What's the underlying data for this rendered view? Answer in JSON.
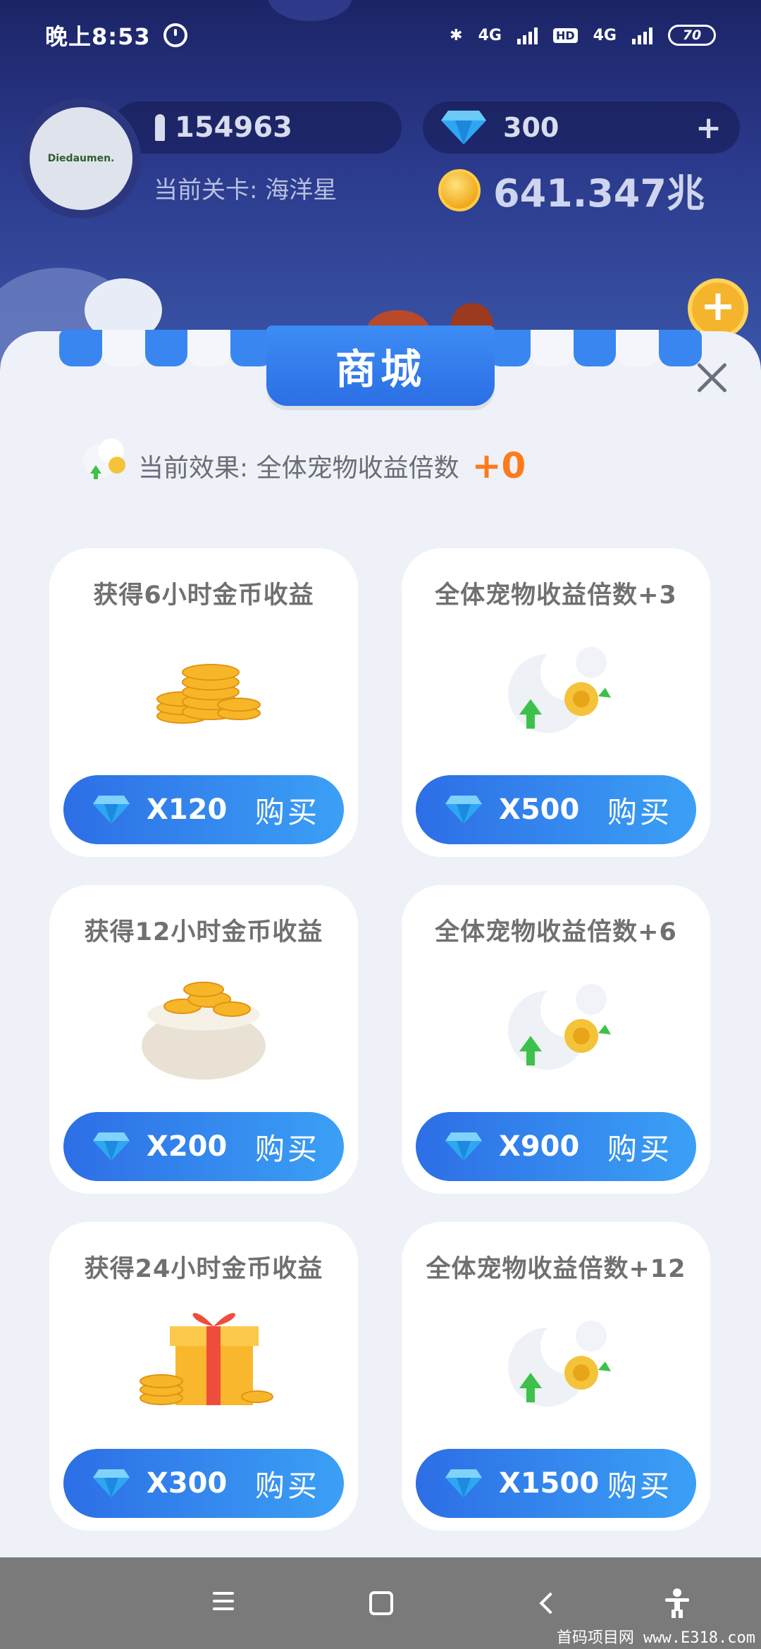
{
  "status_bar": {
    "time": "晚上8:53",
    "network_1": "4G",
    "hd_badge": "HD",
    "network_2": "4G",
    "battery": "70"
  },
  "player": {
    "avatar_text": "Diedaumen.",
    "score": "154963",
    "current_level_label": "当前关卡: 海洋星",
    "gems": "300",
    "gems_add": "+",
    "coins": "641.347兆"
  },
  "shop": {
    "title": "商城",
    "current_effect_label": "当前效果: 全体宠物收益倍数",
    "current_effect_value": "+0",
    "buy_label": "购买",
    "items": [
      {
        "title": "获得6小时金币收益",
        "price": "X120",
        "art": "coin-stack"
      },
      {
        "title": "全体宠物收益倍数+3",
        "price": "X500",
        "art": "cloud-boost"
      },
      {
        "title": "获得12小时金币收益",
        "price": "X200",
        "art": "coin-bag"
      },
      {
        "title": "全体宠物收益倍数+6",
        "price": "X900",
        "art": "cloud-boost"
      },
      {
        "title": "获得24小时金币收益",
        "price": "X300",
        "art": "gift-box"
      },
      {
        "title": "全体宠物收益倍数+12",
        "price": "X1500",
        "art": "cloud-boost"
      }
    ]
  },
  "colors": {
    "accent_blue": "#2d6ee6",
    "effect_orange": "#ff7a1a",
    "card_bg": "#ffffff",
    "sheet_bg": "#eef1f8"
  },
  "watermark": "首码项目网  www.E318.com"
}
